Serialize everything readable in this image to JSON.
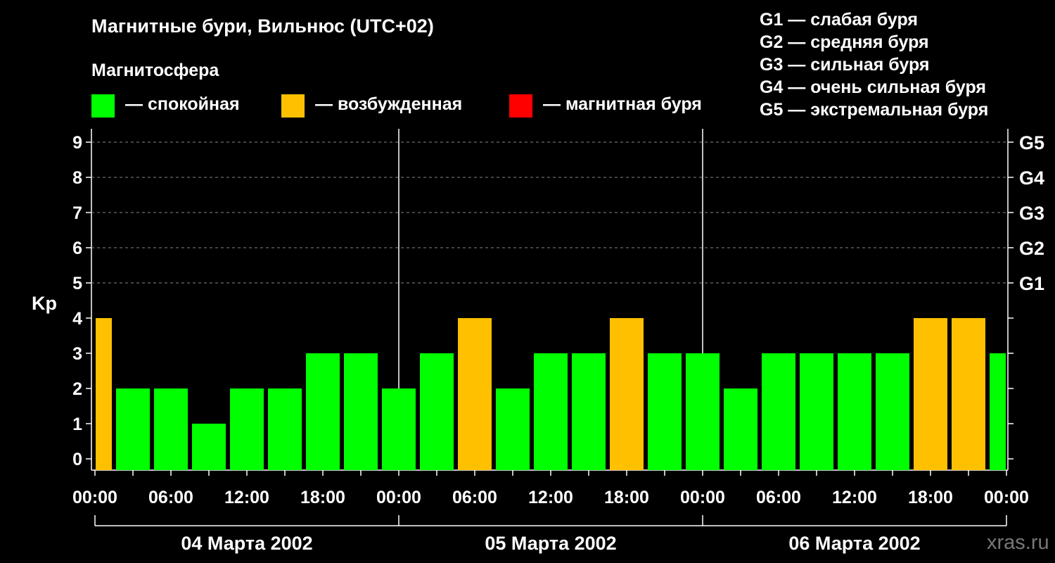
{
  "header": {
    "title": "Магнитные бури, Вильнюс (UTC+02)",
    "magnetosphere_label": "Магнитосфера"
  },
  "legend": {
    "calm": {
      "label": "— спокойная",
      "color": "#00ff00"
    },
    "excited": {
      "label": "— возбужденная",
      "color": "#ffc000"
    },
    "storm": {
      "label": "— магнитная буря",
      "color": "#ff0000"
    }
  },
  "g_legend": [
    "G1 — слабая буря",
    "G2 — средняя буря",
    "G3 — сильная буря",
    "G4 — очень сильная буря",
    "G5 — экстремальная буря"
  ],
  "watermark": "xras.ru",
  "chart_data": {
    "type": "bar",
    "ylabel": "Kp",
    "ylim": [
      0,
      9
    ],
    "yticks": [
      0,
      1,
      2,
      3,
      4,
      5,
      6,
      7,
      8,
      9
    ],
    "g_levels": [
      {
        "label": "G1",
        "kp": 5
      },
      {
        "label": "G2",
        "kp": 6
      },
      {
        "label": "G3",
        "kp": 7
      },
      {
        "label": "G4",
        "kp": 8
      },
      {
        "label": "G5",
        "kp": 9
      }
    ],
    "x_tick_labels": [
      "00:00",
      "06:00",
      "12:00",
      "18:00",
      "00:00",
      "06:00",
      "12:00",
      "18:00",
      "00:00",
      "06:00",
      "12:00",
      "18:00",
      "00:00"
    ],
    "days": [
      "04 Марта 2002",
      "05 Марта 2002",
      "06 Марта 2002"
    ],
    "grid": true,
    "interval_hours": 3,
    "values": [
      4,
      2,
      2,
      1,
      2,
      2,
      3,
      3,
      2,
      3,
      4,
      2,
      3,
      3,
      4,
      3,
      3,
      2,
      3,
      3,
      3,
      3,
      4,
      4,
      3
    ],
    "color_rule": {
      "calm_below": 4,
      "excited_from": 4,
      "storm_from": 5
    }
  }
}
